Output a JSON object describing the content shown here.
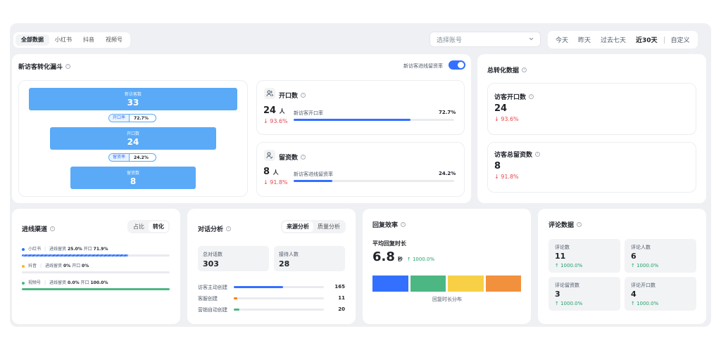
{
  "platform_tabs": [
    "全部数据",
    "小红书",
    "抖音",
    "视频号"
  ],
  "account_select": {
    "placeholder": "选择账号"
  },
  "date_tabs": [
    "今天",
    "昨天",
    "过去七天",
    "近30天",
    "自定义"
  ],
  "funnel_card": {
    "title": "新访客转化漏斗",
    "toggle_label": "新访客进线留资率",
    "toggle_on": true,
    "stages": [
      {
        "label": "新访客数",
        "value": "33"
      },
      {
        "label": "开口数",
        "value": "24"
      },
      {
        "label": "留资数",
        "value": "8"
      }
    ],
    "rates": [
      {
        "label": "开口率",
        "value": "72.7%"
      },
      {
        "label": "留资率",
        "value": "24.2%"
      }
    ],
    "open": {
      "title": "开口数",
      "value": "24",
      "unit": "人",
      "change": "↓ 93.6%",
      "rate_label": "新访客开口率",
      "rate_value": "72.7%",
      "progress": 0.727
    },
    "lead": {
      "title": "留资数",
      "value": "8",
      "unit": "人",
      "change": "↓ 91.8%",
      "rate_label": "新访客进线留资率",
      "rate_value": "24.2%",
      "progress": 0.242
    }
  },
  "total_card": {
    "title": "总转化数据",
    "items": [
      {
        "title": "访客开口数",
        "value": "24",
        "change": "↓ 93.6%"
      },
      {
        "title": "访客总留资数",
        "value": "8",
        "change": "↓ 91.8%"
      }
    ]
  },
  "channel_card": {
    "title": "进线渠道",
    "tabs": [
      "占比",
      "转化"
    ],
    "active_tab": "转化",
    "rows": [
      {
        "name": "小红书",
        "lead_label": "进线留资",
        "lead": "25.0%",
        "open_label": "开口",
        "open": "71.9%",
        "color": "#3370ff",
        "progress": 0.72
      },
      {
        "name": "抖音",
        "lead_label": "进线留资",
        "lead": "0%",
        "open_label": "开口",
        "open": "0%",
        "color": "#f7ba1e",
        "progress": 0
      },
      {
        "name": "视频号",
        "lead_label": "进线留资",
        "lead": "0.0%",
        "open_label": "开口",
        "open": "100.0%",
        "color": "#4cb782",
        "progress": 1.0
      }
    ]
  },
  "dialog_card": {
    "title": "对话分析",
    "tabs": [
      "来源分析",
      "质量分析"
    ],
    "active_tab": "来源分析",
    "stats": [
      {
        "label": "总对话数",
        "value": "303"
      },
      {
        "label": "接待人数",
        "value": "28"
      }
    ],
    "sources": [
      {
        "label": "访客主动创建",
        "value": "165",
        "color": "#3370ff",
        "progress": 0.545
      },
      {
        "label": "客服创建",
        "value": "11",
        "color": "#ff7d00",
        "progress": 0.036
      },
      {
        "label": "营销自动创建",
        "value": "20",
        "color": "#4cb782",
        "progress": 0.066
      }
    ]
  },
  "reply_card": {
    "title": "回复效率",
    "subtitle": "平均回复时长",
    "value": "6.8",
    "unit": "秒",
    "change": "↑ 1000.0%",
    "dist_label": "回复时长分布",
    "segments": [
      "#3370ff",
      "#4cb782",
      "#f7d046",
      "#f2913d"
    ]
  },
  "comment_card": {
    "title": "评论数据",
    "items": [
      {
        "label": "评论数",
        "value": "11",
        "change": "↑ 1000.0%"
      },
      {
        "label": "评论人数",
        "value": "6",
        "change": "↑ 1000.0%"
      },
      {
        "label": "评论留资数",
        "value": "3",
        "change": "↑ 1000.0%"
      },
      {
        "label": "评论开口数",
        "value": "4",
        "change": "↑ 1000.0%"
      }
    ]
  }
}
